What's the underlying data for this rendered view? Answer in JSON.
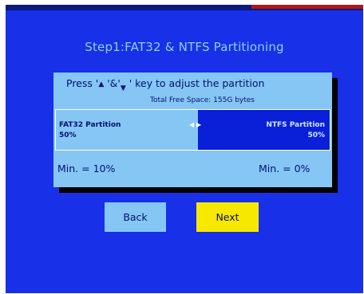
{
  "screen": {
    "title": "Step1:FAT32 & NTFS Partitioning"
  },
  "panel": {
    "instruction_prefix": "Press '",
    "instruction_mid": " '&'",
    "instruction_suffix": " ' key to adjust the partition",
    "total_free_space": "Total Free Space: 155G bytes",
    "fat32_label": "FAT32 Partition",
    "fat32_percent": "50%",
    "ntfs_label": "NTFS Partition",
    "ntfs_percent": "50%",
    "min_fat32": "Min. = 10%",
    "min_ntfs": "Min. = 0%",
    "split_fraction": 0.5
  },
  "buttons": {
    "back_label": "Back",
    "next_label": "Next"
  },
  "icons": {
    "up": "up-triangle-icon",
    "down": "down-triangle-icon",
    "left": "left-arrow-icon",
    "right": "right-arrow-icon"
  },
  "colors": {
    "background": "#1730e8",
    "panel": "#85c6f5",
    "ntfs_fill": "#0a1fd8",
    "next_button": "#f7e800",
    "title_text": "#8fd0ff"
  }
}
